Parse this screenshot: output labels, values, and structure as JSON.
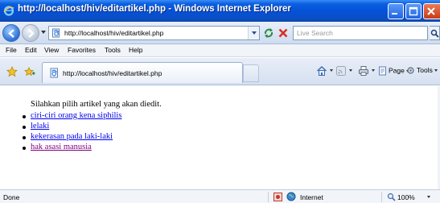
{
  "window": {
    "title": "http://localhost/hiv/editartikel.php - Windows Internet Explorer"
  },
  "address_bar": {
    "url": "http://localhost/hiv/editartikel.php"
  },
  "search": {
    "placeholder": "Live Search"
  },
  "menu": [
    "File",
    "Edit",
    "View",
    "Favorites",
    "Tools",
    "Help"
  ],
  "tab": {
    "label": "http://localhost/hiv/editartikel.php"
  },
  "toolbar": {
    "page_label": "Page",
    "tools_label": "Tools"
  },
  "content": {
    "intro": "Silahkan pilih artikel yang akan diedit.",
    "articles": [
      "ciri-ciri orang kena siphilis",
      "lelaki",
      "kekerasan pada laki-laki",
      "hak asasi manusia"
    ]
  },
  "status": {
    "text": "Done",
    "zone": "Internet",
    "zoom": "100%"
  },
  "colors": {
    "link": "#0000ee",
    "visited_link": "#800080",
    "title_bar": "#0550d6"
  },
  "icons": [
    "ie-logo-icon",
    "minimize-icon",
    "maximize-icon",
    "close-icon",
    "back-icon",
    "forward-icon",
    "page-icon",
    "refresh-icon",
    "stop-icon",
    "search-icon",
    "favorites-star-icon",
    "add-favorites-icon",
    "home-icon",
    "feeds-icon",
    "print-icon",
    "page-menu-icon",
    "tools-menu-icon",
    "protected-mode-icon",
    "globe-icon",
    "zoom-icon"
  ]
}
